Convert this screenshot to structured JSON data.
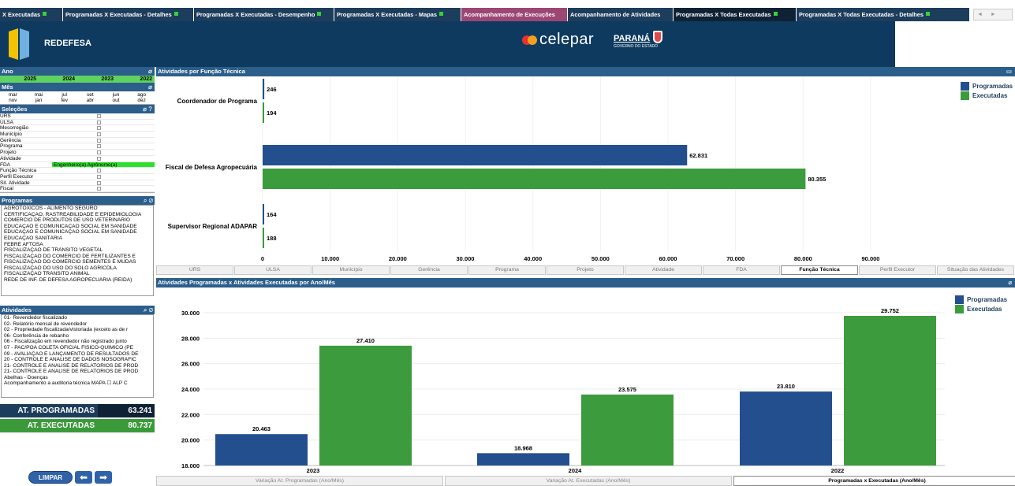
{
  "tabs": [
    {
      "label": "X Executadas",
      "marker": true
    },
    {
      "label": "Programadas X Executadas - Detalhes",
      "marker": true
    },
    {
      "label": "Programadas X Executadas - Desempenho",
      "marker": true
    },
    {
      "label": "Programadas X Executadas - Mapas",
      "marker": true
    },
    {
      "label": "Acompanhamento de Execuções",
      "marker": false
    },
    {
      "label": "Acompanhamento de Atividades",
      "marker": false
    },
    {
      "label": "Programadas X Todas Executadas",
      "marker": true
    },
    {
      "label": "Programadas X Todas Executadas - Detalhes",
      "marker": true
    }
  ],
  "tab_scroll": "◄ ► ▼",
  "header": {
    "brand": "REDEFESA",
    "celepar": "celepar",
    "parana": "PARANÁ",
    "parana_sub": "GOVERNO DO ESTADO"
  },
  "colors": {
    "programadas": "#234f8e",
    "executadas": "#3c9b3c",
    "header_bg": "#0e3a60",
    "panel_title": "#2b5e8a"
  },
  "ano": {
    "title": "Ano",
    "values": [
      "2025",
      "2024",
      "2023",
      "2022"
    ]
  },
  "mes": {
    "title": "Mês",
    "values": [
      "mar",
      "mai",
      "jul",
      "set",
      "jun",
      "ago",
      "nov",
      "jan",
      "fev",
      "abr",
      "out",
      "dez"
    ]
  },
  "selecoes": {
    "title": "Seleções",
    "rows": [
      {
        "label": "URS",
        "value": ""
      },
      {
        "label": "ULSA",
        "value": ""
      },
      {
        "label": "Mesorregião",
        "value": ""
      },
      {
        "label": "Município",
        "value": ""
      },
      {
        "label": "Gerência",
        "value": ""
      },
      {
        "label": "Programa",
        "value": ""
      },
      {
        "label": "Projeto",
        "value": ""
      },
      {
        "label": "Atividade",
        "value": ""
      },
      {
        "label": "FDA",
        "value": "Engenheiro(a) Agrônomo(a)"
      },
      {
        "label": "Função Técnica",
        "value": ""
      },
      {
        "label": "Perfil Executor",
        "value": ""
      },
      {
        "label": "Sit. Atividade",
        "value": ""
      },
      {
        "label": "Fiscal",
        "value": ""
      }
    ]
  },
  "programas": {
    "title": "Programas",
    "items": [
      "AGROTÓXICOS - ALIMENTO SEGURO",
      "CERTIFICAÇÃO, RASTREABILIDADE E EPIDEMIOLOGIA",
      "COMÉRCIO DE PRODUTOS DE USO VETERINÁRIO",
      "EDUCAÇÃO E COMUNICAÇÃO SOCIAL EM SANIDADE",
      "EDUCAÇÃO E COMUNICAÇÃO SOCIAL EM SANIDADE",
      "EDUCAÇÃO SANITÁRIA",
      "FEBRE AFTOSA",
      "FISCALIZAÇÃO DE TRÂNSITO VEGETAL",
      "FISCALIZAÇÃO DO COMÉRCIO DE FERTILIZANTES E",
      "FISCALIZAÇÃO DO COMÉRCIO SEMENTES E MUDAS",
      "FISCALIZAÇÃO DO USO DO SOLO AGRÍCOLA",
      "FISCALIZAÇÃO TRÂNSITO ANIMAL",
      "REDE DE INF. DE DEFESA AGROPECUÁRIA (REIDA)"
    ]
  },
  "atividades": {
    "title": "Atividades",
    "items": [
      "01- Revendedor fiscalizado",
      "02- Relatório mensal de revendedor",
      "02 - Propriedade fiscalizada/vistoriada (exceto as de r",
      "06- Conferência de rebanho",
      "06 - Fiscalização em revendedor não registrado junto",
      "07 - PAC/POA COLETA OFICIAL FÍSICO-QUÍMICO (PE",
      "09 - AVALIAÇÃO E LANÇAMENTO DE RESULTADOS DE",
      "20 - CONTROLE E ANÁLISE DE DADOS NOSOGRÁFIC",
      "21- CONTROLE E ANÁLISE DE RELATÓRIOS DE PROD",
      "21- CONTROLE E ANÁLISE DE RELATÓRIOS DE PROD",
      "Abelhas - Doenças",
      "Acompanhamento a auditoria técnica MAPA ☐ ALP C"
    ]
  },
  "totals": {
    "programadas_label": "AT. PROGRAMADAS",
    "programadas_value": "63.241",
    "executadas_label": "AT. EXECUTADAS",
    "executadas_value": "80.737"
  },
  "buttons": {
    "limpar": "LIMPAR"
  },
  "top_panel": {
    "title": "Atividades por Função Técnica",
    "dim_tabs": [
      "URS",
      "ULSA",
      "Município",
      "Gerência",
      "Programa",
      "Projeto",
      "Atividade",
      "FDA",
      "Função Técnica",
      "Perfil Executor",
      "Situação das Atividades"
    ],
    "active_tab": "Função Técnica"
  },
  "bottom_panel": {
    "title": "Atividades Programadas x Atividades Executadas por Ano/Mês",
    "tabs": [
      "Variação At. Programadas (Ano/Mês)",
      "Variação At. Executadas (Ano/Mês)",
      "Programadas x Executadas (Ano/Mês)"
    ],
    "active_tab": "Programadas x Executadas (Ano/Mês)"
  },
  "chart_data": [
    {
      "type": "bar",
      "orientation": "horizontal",
      "title": "Atividades por Função Técnica",
      "categories": [
        "Coordenador de Programa",
        "Fiscal de Defesa Agropecuária",
        "Supervisor Regional ADAPAR"
      ],
      "series": [
        {
          "name": "Programadas",
          "values": [
            246,
            62831,
            164
          ],
          "labels": [
            "246",
            "62.831",
            "164"
          ]
        },
        {
          "name": "Executadas",
          "values": [
            194,
            80355,
            188
          ],
          "labels": [
            "194",
            "80.355",
            "188"
          ]
        }
      ],
      "xlim": [
        0,
        90000
      ],
      "xticks": [
        "0",
        "10.000",
        "20.000",
        "30.000",
        "40.000",
        "50.000",
        "60.000",
        "70.000",
        "80.000",
        "90.000"
      ],
      "legend": "top-right",
      "grid": false
    },
    {
      "type": "bar",
      "orientation": "vertical",
      "title": "Atividades Programadas x Atividades Executadas por Ano/Mês",
      "categories": [
        "2023",
        "2024",
        "2022"
      ],
      "series": [
        {
          "name": "Programadas",
          "values": [
            20463,
            18968,
            23810
          ],
          "labels": [
            "20.463",
            "18.968",
            "23.810"
          ]
        },
        {
          "name": "Executadas",
          "values": [
            27410,
            23575,
            29752
          ],
          "labels": [
            "27.410",
            "23.575",
            "29.752"
          ]
        }
      ],
      "ylim": [
        18000,
        30000
      ],
      "yticks": [
        "18.000",
        "20.000",
        "22.000",
        "24.000",
        "26.000",
        "28.000",
        "30.000"
      ],
      "legend": "top-right",
      "grid": true
    }
  ]
}
